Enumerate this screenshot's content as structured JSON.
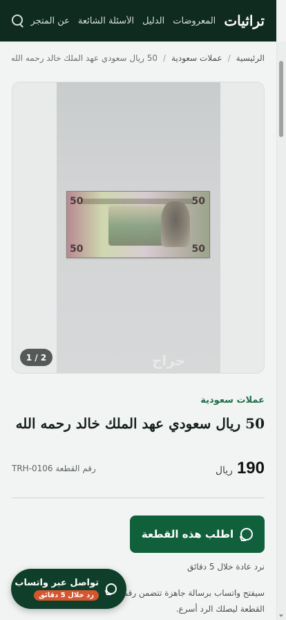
{
  "header": {
    "brand": "تراثيات",
    "nav": [
      "المعروضات",
      "الدليل",
      "الأسئلة الشائعة",
      "عن المتجر"
    ],
    "search_icon": "search-icon"
  },
  "breadcrumb": {
    "home": "الرئيسية",
    "category": "عملات سعودية",
    "current": "50 ريال سعودي عهد الملك خالد رحمه الله"
  },
  "gallery": {
    "counter": "1 / 2",
    "watermark": "حراج",
    "note_denomination": "50"
  },
  "product": {
    "category": "عملات سعودية",
    "title": "50 ريال سعودي عهد الملك خالد رحمه الله",
    "price": "190",
    "currency": "ريال",
    "piece_number": "رقم القطعة TRH-0106"
  },
  "actions": {
    "order_label": "اطلب هذه القطعة",
    "reply_note": "نرد عادة خلال 5 دقائق",
    "description": "سيفتح واتساب برسالة جاهزة تتضمن رقم القطعة ليصلك الرد أسرع."
  },
  "floating": {
    "title": "تواصل عبر واتساب",
    "badge": "رد خلال 5 دقائق"
  }
}
